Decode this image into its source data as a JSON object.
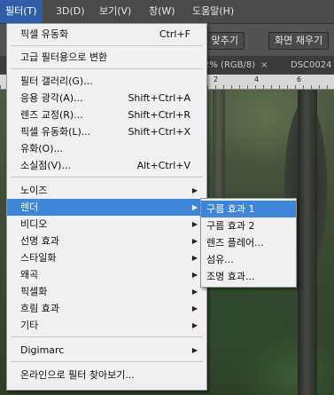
{
  "menubar": {
    "items": [
      "필터(T)",
      "3D(D)",
      "보기(V)",
      "창(W)",
      "도움말(H)"
    ]
  },
  "options_bar": {
    "buttons": [
      "면 맞추기",
      "화면 채우기"
    ]
  },
  "tabs": [
    {
      "label": "2% (RGB/8)",
      "close": "×"
    },
    {
      "label": "DSC0024",
      "close": ""
    }
  ],
  "ruler": {
    "labels": [
      "2",
      "4",
      "6"
    ]
  },
  "filter_menu": {
    "items": [
      {
        "label": "픽셀 유동화",
        "shortcut": "Ctrl+F"
      },
      {
        "label": "고급 필터용으로 변환",
        "shortcut": ""
      },
      {
        "label": "필터 갤러리(G)...",
        "shortcut": ""
      },
      {
        "label": "응용 광각(A)...",
        "shortcut": "Shift+Ctrl+A"
      },
      {
        "label": "렌즈 교정(R)...",
        "shortcut": "Shift+Ctrl+R"
      },
      {
        "label": "픽셀 유동화(L)...",
        "shortcut": "Shift+Ctrl+X"
      },
      {
        "label": "유화(O)...",
        "shortcut": ""
      },
      {
        "label": "소실점(V)...",
        "shortcut": "Alt+Ctrl+V"
      },
      {
        "label": "노이즈",
        "arrow": "▶"
      },
      {
        "label": "렌더",
        "arrow": "▶"
      },
      {
        "label": "비디오",
        "arrow": "▶"
      },
      {
        "label": "선명 효과",
        "arrow": "▶"
      },
      {
        "label": "스타일화",
        "arrow": "▶"
      },
      {
        "label": "왜곡",
        "arrow": "▶"
      },
      {
        "label": "픽셀화",
        "arrow": "▶"
      },
      {
        "label": "흐림 효과",
        "arrow": "▶"
      },
      {
        "label": "기타",
        "arrow": "▶"
      },
      {
        "label": "Digimarc",
        "arrow": "▶"
      },
      {
        "label": "온라인으로 필터 찾아보기...",
        "shortcut": ""
      }
    ]
  },
  "render_submenu": {
    "items": [
      "구름 효과 1",
      "구름 효과 2",
      "렌즈 플레어...",
      "섬유...",
      "조명 효과..."
    ]
  },
  "colors": {
    "highlight": "#3d86d8",
    "menu_bg": "#f0f0f0",
    "menubar_bg": "#4a4a4a"
  }
}
